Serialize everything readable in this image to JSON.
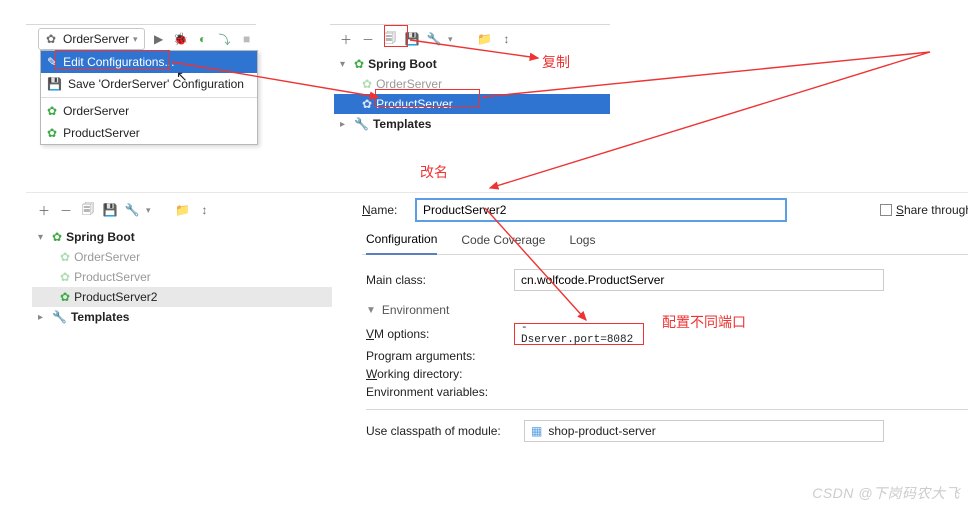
{
  "top": {
    "runCombo": "OrderServer",
    "dropdown": {
      "edit": "Edit Configurations...",
      "save": "Save 'OrderServer' Configuration",
      "items": [
        "OrderServer",
        "ProductServer"
      ]
    }
  },
  "panelA": {
    "root": "Spring Boot",
    "items": [
      "OrderServer",
      "ProductServer"
    ],
    "templates": "Templates"
  },
  "annotations": {
    "copy": "复制",
    "rename": "改名",
    "port": "配置不同端口"
  },
  "panelB": {
    "root": "Spring Boot",
    "items": [
      "OrderServer",
      "ProductServer",
      "ProductServer2"
    ],
    "templates": "Templates"
  },
  "detail": {
    "nameLabel": "Name:",
    "name": "ProductServer2",
    "share": "Share through",
    "tabs": [
      "Configuration",
      "Code Coverage",
      "Logs"
    ],
    "mainClassLabel": "Main class:",
    "mainClass": "cn.wolfcode.ProductServer",
    "env": "Environment",
    "vmLabel": "VM options:",
    "vm": "-Dserver.port=8082",
    "argsLabel": "Program arguments:",
    "wdLabel": "Working directory:",
    "envVarLabel": "Environment variables:",
    "cpLabel": "Use classpath of module:",
    "cp": "shop-product-server"
  },
  "watermark": "CSDN @下岗码农大飞"
}
